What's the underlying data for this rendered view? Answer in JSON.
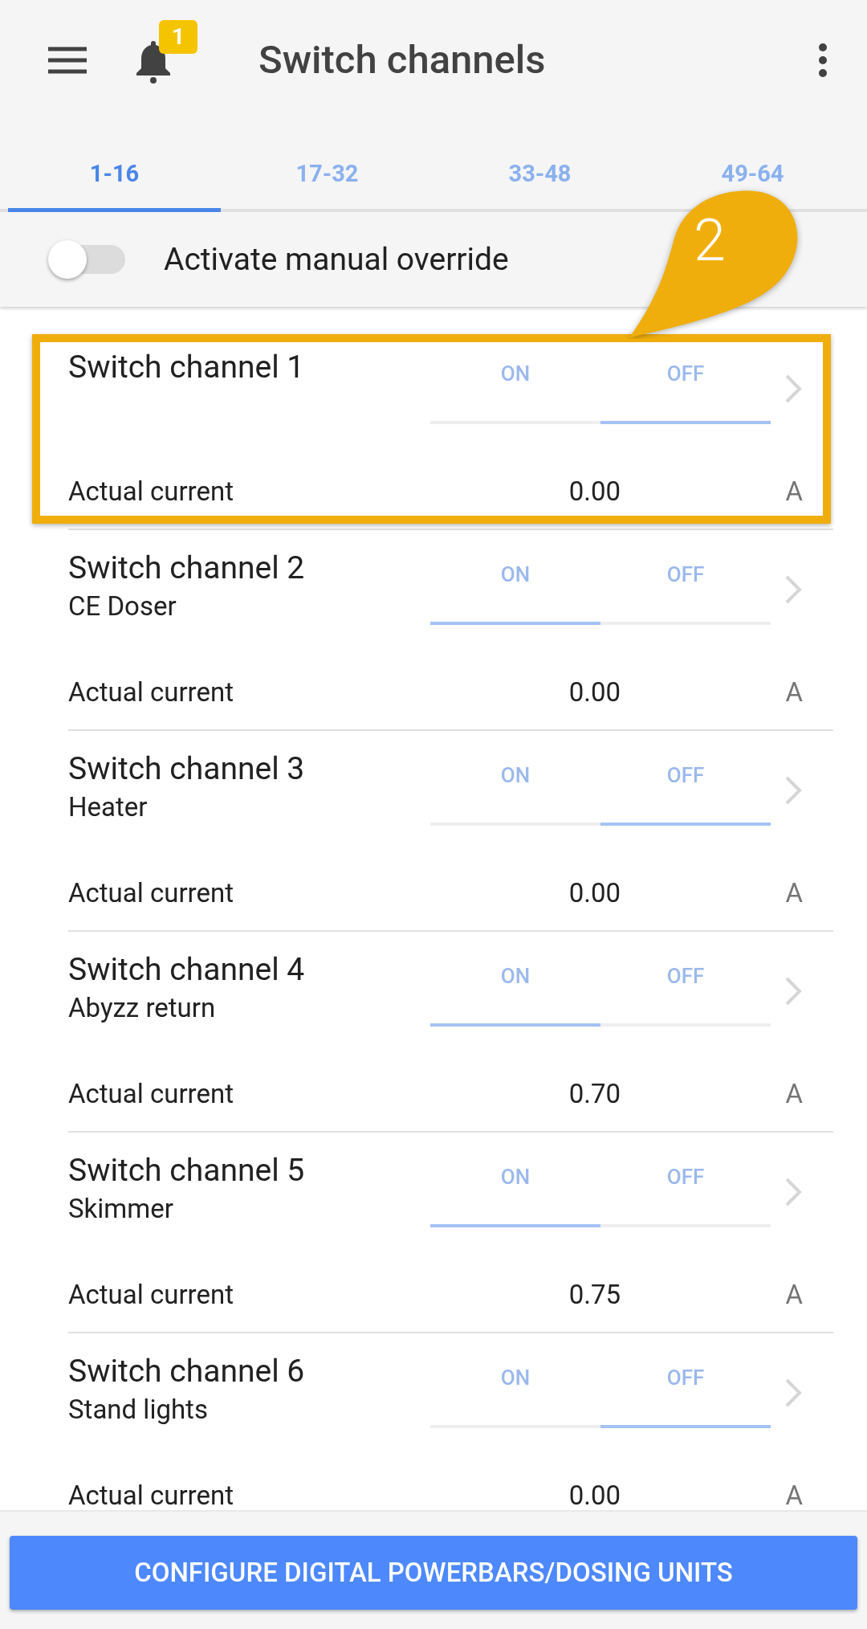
{
  "header": {
    "title": "Switch channels",
    "notification_badge": "1"
  },
  "tabs": [
    {
      "label": "1-16",
      "selected": true
    },
    {
      "label": "17-32",
      "selected": false
    },
    {
      "label": "33-48",
      "selected": false
    },
    {
      "label": "49-64",
      "selected": false
    }
  ],
  "override": {
    "label": "Activate manual override",
    "on": false
  },
  "annotation": {
    "label": "2"
  },
  "channels": [
    {
      "name": "Switch channel 1",
      "highlighted": true,
      "options": [
        {
          "label": "ON",
          "selected": false
        },
        {
          "label": "OFF",
          "selected": true
        }
      ],
      "current_label": "Actual current",
      "current": "0.00",
      "unit": "A"
    },
    {
      "name": "Switch channel 2",
      "subtitle": "CE Doser",
      "highlighted": false,
      "options": [
        {
          "label": "ON",
          "selected": true
        },
        {
          "label": "OFF",
          "selected": false
        }
      ],
      "current_label": "Actual current",
      "current": "0.00",
      "unit": "A"
    },
    {
      "name": "Switch channel 3",
      "subtitle": "Heater",
      "highlighted": false,
      "options": [
        {
          "label": "ON",
          "selected": false
        },
        {
          "label": "OFF",
          "selected": true
        }
      ],
      "current_label": "Actual current",
      "current": "0.00",
      "unit": "A"
    },
    {
      "name": "Switch channel 4",
      "subtitle": "Abyzz return",
      "highlighted": false,
      "options": [
        {
          "label": "ON",
          "selected": true
        },
        {
          "label": "OFF",
          "selected": false
        }
      ],
      "current_label": "Actual current",
      "current": "0.70",
      "unit": "A"
    },
    {
      "name": "Switch channel 5",
      "subtitle": "Skimmer",
      "highlighted": false,
      "options": [
        {
          "label": "ON",
          "selected": true
        },
        {
          "label": "OFF",
          "selected": false
        }
      ],
      "current_label": "Actual current",
      "current": "0.75",
      "unit": "A"
    },
    {
      "name": "Switch channel 6",
      "subtitle": "Stand lights",
      "highlighted": false,
      "options": [
        {
          "label": "ON",
          "selected": false
        },
        {
          "label": "OFF",
          "selected": true
        }
      ],
      "current_label": "Actual current",
      "current": "0.00",
      "unit": "A"
    }
  ],
  "footer_button": "CONFIGURE DIGITAL POWERBARS/DOSING UNITS"
}
